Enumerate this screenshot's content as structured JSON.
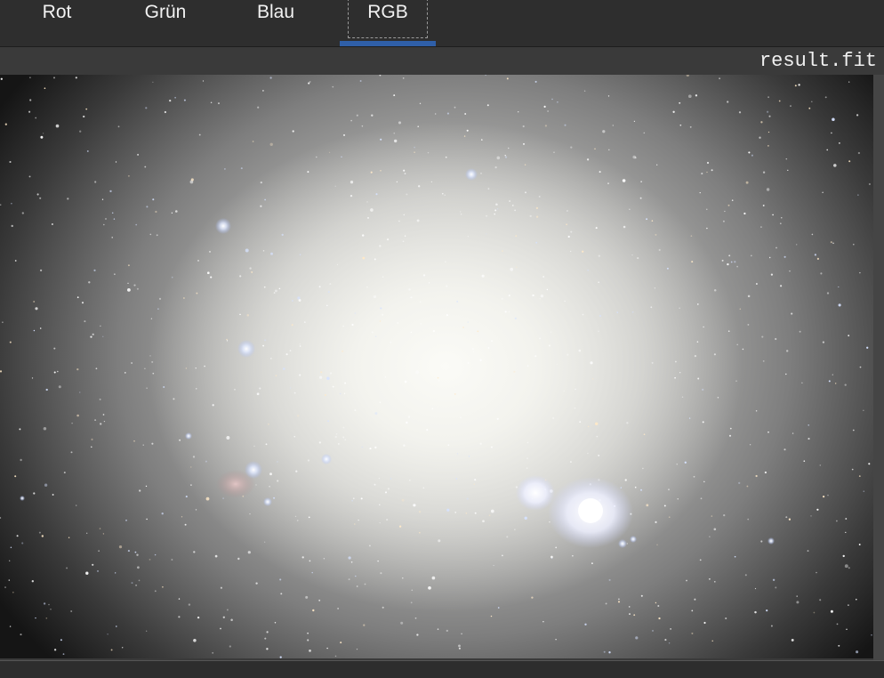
{
  "tabs": [
    {
      "label": "Rot",
      "active": false
    },
    {
      "label": "Grün",
      "active": false
    },
    {
      "label": "Blau",
      "active": false
    },
    {
      "label": "RGB",
      "active": true
    }
  ],
  "file": {
    "name": "result.fit"
  },
  "colors": {
    "active_tab_underline": "#2f5fa8",
    "background": "#2b2b2b",
    "text": "#f2f2f2"
  }
}
